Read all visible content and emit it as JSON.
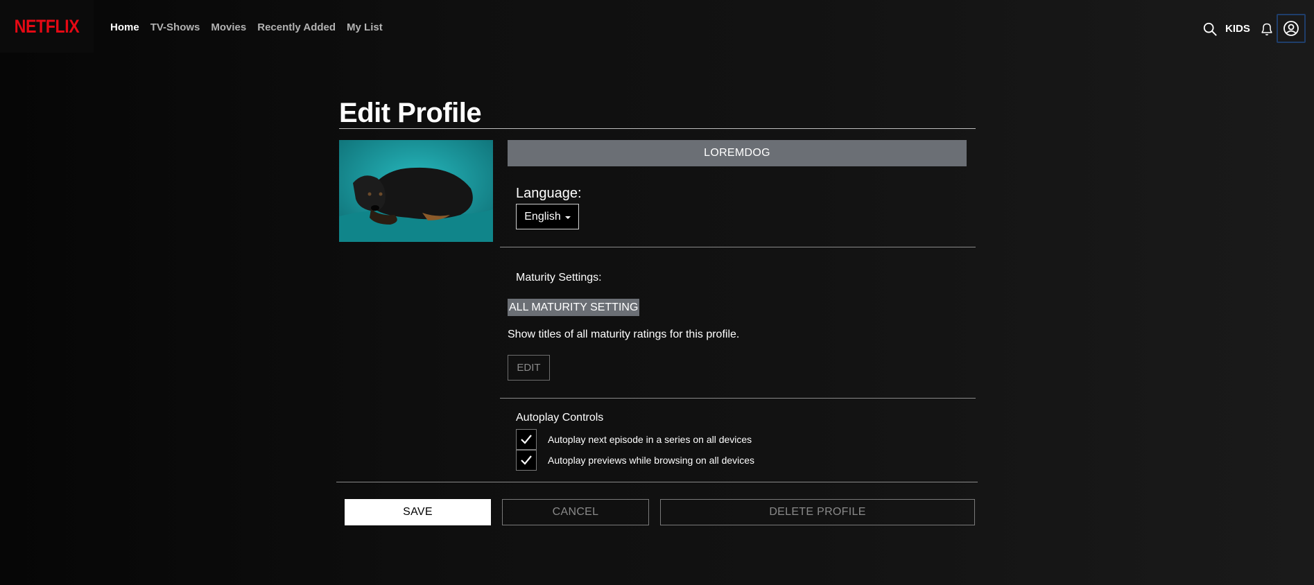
{
  "brand": {
    "logo": "NETFLIX",
    "color": "#e50914"
  },
  "nav": {
    "items": [
      {
        "label": "Home",
        "active": true
      },
      {
        "label": "TV-Shows",
        "active": false
      },
      {
        "label": "Movies",
        "active": false
      },
      {
        "label": "Recently Added",
        "active": false
      },
      {
        "label": "My List",
        "active": false
      }
    ]
  },
  "header_tools": {
    "kids_label": "KIDS",
    "icons": [
      "search-icon",
      "bell-icon",
      "user-avatar-icon"
    ]
  },
  "page": {
    "title": "Edit Profile"
  },
  "profile": {
    "name": "LOREMDOG",
    "image_alt": "black dog on teal background"
  },
  "language": {
    "label": "Language:",
    "selected": "English"
  },
  "maturity": {
    "label": "Maturity Settings:",
    "badge": "ALL MATURITY SETTING",
    "description": "Show titles of all maturity ratings for this profile.",
    "edit_label": "EDIT"
  },
  "autoplay": {
    "label": "Autoplay Controls",
    "options": [
      {
        "label": "Autoplay next episode in a series on all devices",
        "checked": true
      },
      {
        "label": "Autoplay previews while browsing on all devices",
        "checked": true
      }
    ]
  },
  "actions": {
    "save": "SAVE",
    "cancel": "CANCEL",
    "delete": "DELETE PROFILE"
  }
}
